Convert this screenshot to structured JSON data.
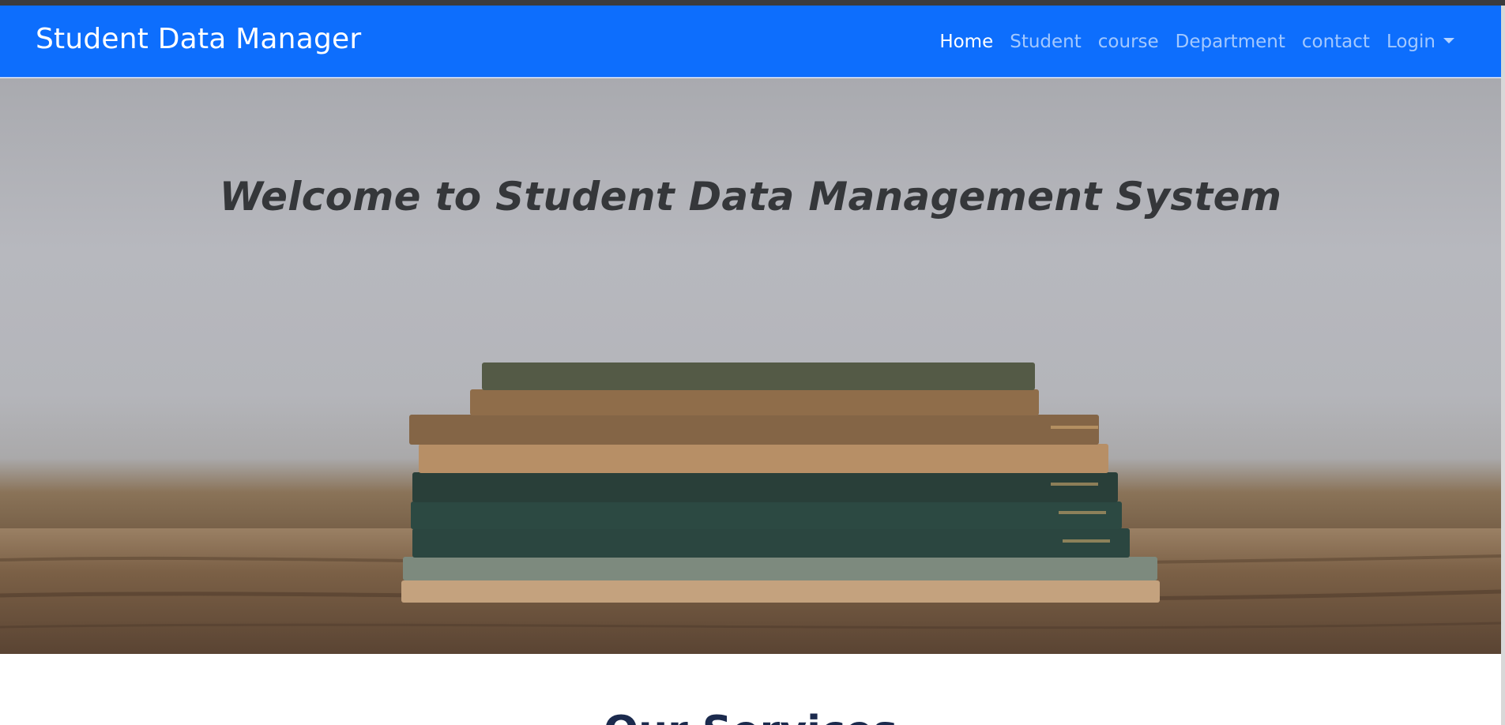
{
  "navbar": {
    "brand": "Student Data Manager",
    "links": [
      {
        "label": "Home",
        "active": true
      },
      {
        "label": "Student",
        "active": false
      },
      {
        "label": "course",
        "active": false
      },
      {
        "label": "Department",
        "active": false
      },
      {
        "label": "contact",
        "active": false
      }
    ],
    "dropdown": {
      "label": "Login"
    }
  },
  "hero": {
    "title": "Welcome to Student Data Management System"
  },
  "section": {
    "heading_partial": "Our Services"
  },
  "colors": {
    "navbar_bg": "#0d6efd",
    "hero_title": "#35373a"
  }
}
